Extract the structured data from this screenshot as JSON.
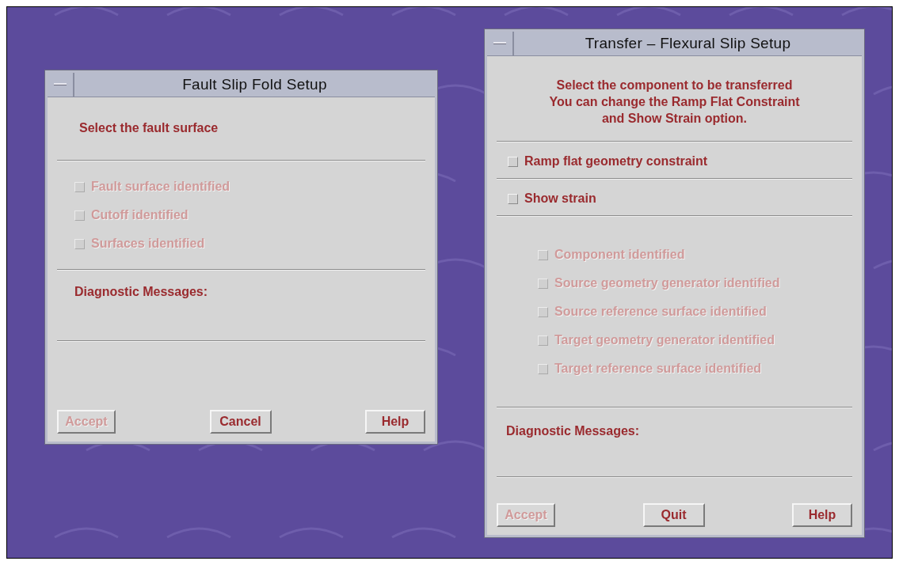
{
  "windows": [
    {
      "title": "Fault Slip Fold Setup",
      "sections": [
        {
          "kind": "message",
          "lines": [
            "Select the fault surface"
          ]
        },
        {
          "kind": "checks",
          "items": [
            {
              "label": "Fault surface identified",
              "checked": false,
              "disabled": true
            },
            {
              "label": "Cutoff identified",
              "checked": false,
              "disabled": true
            },
            {
              "label": "Surfaces identified",
              "checked": false,
              "disabled": true
            }
          ]
        },
        {
          "kind": "diagnostics",
          "label": "Diagnostic Messages:"
        }
      ],
      "buttons": [
        {
          "label": "Accept",
          "disabled": true
        },
        {
          "label": "Cancel",
          "disabled": false
        },
        {
          "label": "Help",
          "disabled": false
        }
      ]
    },
    {
      "title": "Transfer – Flexural Slip Setup",
      "sections": [
        {
          "kind": "message",
          "lines": [
            "Select the component to be transferred",
            "You can change the Ramp Flat Constraint",
            "and Show Strain option."
          ]
        },
        {
          "kind": "checks",
          "items": [
            {
              "label": "Ramp flat geometry constraint",
              "checked": false,
              "disabled": false
            }
          ]
        },
        {
          "kind": "checks",
          "items": [
            {
              "label": "Show strain",
              "checked": false,
              "disabled": false
            }
          ]
        },
        {
          "kind": "subchecks",
          "items": [
            {
              "label": "Component identified",
              "checked": false,
              "disabled": true
            },
            {
              "label": "Source geometry generator identified",
              "checked": false,
              "disabled": true
            },
            {
              "label": "Source reference surface identified",
              "checked": false,
              "disabled": true
            },
            {
              "label": "Target geometry generator identified",
              "checked": false,
              "disabled": true
            },
            {
              "label": "Target reference surface identified",
              "checked": false,
              "disabled": true
            }
          ]
        },
        {
          "kind": "diagnostics",
          "label": "Diagnostic Messages:"
        }
      ],
      "buttons": [
        {
          "label": "Accept",
          "disabled": true
        },
        {
          "label": "Quit",
          "disabled": false
        },
        {
          "label": "Help",
          "disabled": false
        }
      ]
    }
  ]
}
